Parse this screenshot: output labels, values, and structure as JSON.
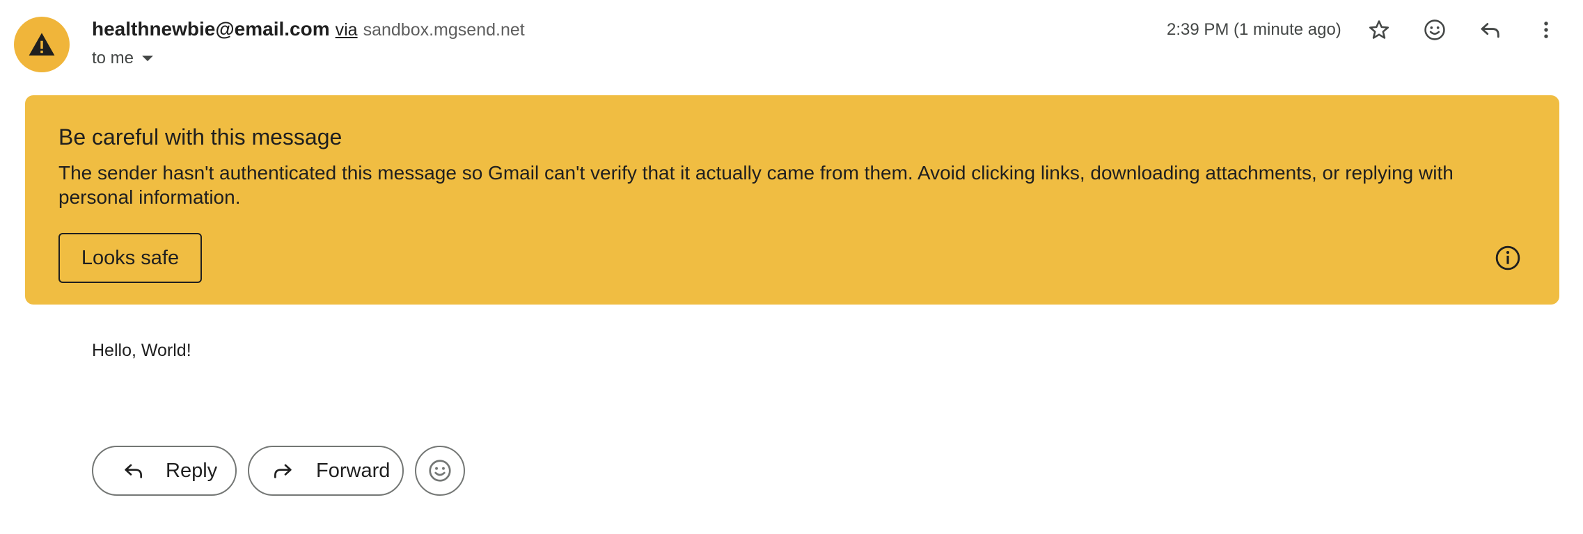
{
  "sender": {
    "email": "healthnewbie@email.com",
    "via_label": "via",
    "via_domain": "sandbox.mgsend.net",
    "to_label": "to me"
  },
  "time": "2:39 PM (1 minute ago)",
  "header_icons": [
    "star-icon",
    "emoji-icon",
    "reply-icon",
    "more-vert-icon"
  ],
  "warning": {
    "title": "Be careful with this message",
    "body": "The sender hasn't authenticated this message so Gmail can't verify that it actually came from them. Avoid clicking links, downloading attachments, or replying with personal information.",
    "button_label": "Looks safe",
    "background_color": "#f0bd42"
  },
  "message": {
    "body": "Hello, World!"
  },
  "actions": {
    "reply_label": "Reply",
    "forward_label": "Forward"
  },
  "colors": {
    "avatar": "#f0b53a",
    "text": "#1f1f1f",
    "secondary_text": "#444746"
  }
}
